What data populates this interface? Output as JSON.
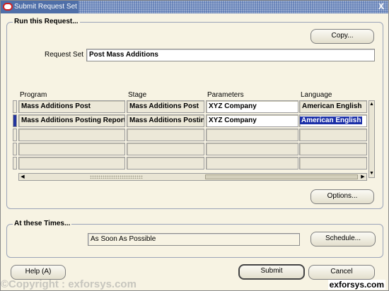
{
  "window": {
    "title": "Submit Request Set",
    "close_symbol": "X"
  },
  "run_group": {
    "label": "Run this Request...",
    "copy_label": "Copy...",
    "request_set_label": "Request Set",
    "request_set_value": "Post Mass Additions",
    "columns": [
      "Program",
      "Stage",
      "Parameters",
      "Language"
    ],
    "rows": [
      {
        "program": "Mass Additions Post",
        "stage": "Mass Additions Post",
        "parameters": "XYZ Company",
        "language": "American English"
      },
      {
        "program": "Mass Additions Posting Report",
        "stage": "Mass Additions Posting",
        "parameters": "XYZ Company",
        "language": "American English"
      },
      {
        "program": "",
        "stage": "",
        "parameters": "",
        "language": ""
      },
      {
        "program": "",
        "stage": "",
        "parameters": "",
        "language": ""
      },
      {
        "program": "",
        "stage": "",
        "parameters": "",
        "language": ""
      }
    ],
    "selected_row": 1,
    "options_label": "Options..."
  },
  "times_group": {
    "label": "At these Times...",
    "schedule_value": "As Soon As Possible",
    "schedule_label": "Schedule..."
  },
  "footer": {
    "help_label": "Help (A)",
    "submit_label": "Submit",
    "cancel_label": "Cancel"
  },
  "watermark": {
    "left": "©Copyright : exforsys.com",
    "right": "exforsys.com"
  },
  "colors": {
    "window_bg": "#f7f3e3",
    "title_bar": "#5b79b3",
    "selection": "#1b2fa8"
  },
  "icons": [
    "oracle-app-icon",
    "close-icon",
    "scroll-up-icon",
    "scroll-down-icon",
    "scroll-left-icon",
    "scroll-right-icon"
  ]
}
